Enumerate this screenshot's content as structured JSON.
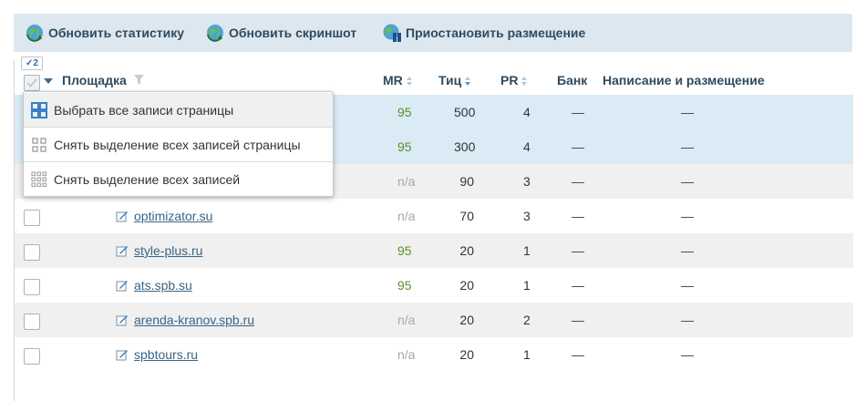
{
  "toolbar": {
    "refresh_stats": "Обновить статистику",
    "refresh_screenshot": "Обновить скриншот",
    "pause_placement": "Приостановить размещение"
  },
  "selection": {
    "count": "2",
    "check_mark": "✓"
  },
  "columns": {
    "site": "Площадка",
    "mr": "MR",
    "tic": "Тиц",
    "pr": "PR",
    "bank": "Банк",
    "writing": "Написание и размещение"
  },
  "dropdown": {
    "select_page": "Выбрать все записи страницы",
    "deselect_page": "Снять выделение всех записей страницы",
    "deselect_all": "Снять выделение всех записей"
  },
  "rows": [
    {
      "site": "",
      "mr": "95",
      "tic": "500",
      "pr": "4",
      "bank": "—",
      "writing": "—",
      "selected": true
    },
    {
      "site": "",
      "mr": "95",
      "tic": "300",
      "pr": "4",
      "bank": "—",
      "writing": "—",
      "selected": true
    },
    {
      "site": "",
      "mr": "n/a",
      "tic": "90",
      "pr": "3",
      "bank": "—",
      "writing": "—",
      "selected": false
    },
    {
      "site": "optimizator.su",
      "mr": "n/a",
      "tic": "70",
      "pr": "3",
      "bank": "—",
      "writing": "—",
      "selected": false
    },
    {
      "site": "style-plus.ru",
      "mr": "95",
      "tic": "20",
      "pr": "1",
      "bank": "—",
      "writing": "—",
      "selected": false
    },
    {
      "site": "ats.spb.su",
      "mr": "95",
      "tic": "20",
      "pr": "1",
      "bank": "—",
      "writing": "—",
      "selected": false
    },
    {
      "site": "arenda-kranov.spb.ru",
      "mr": "n/a",
      "tic": "20",
      "pr": "2",
      "bank": "—",
      "writing": "—",
      "selected": false
    },
    {
      "site": "spbtours.ru",
      "mr": "n/a",
      "tic": "20",
      "pr": "1",
      "bank": "—",
      "writing": "—",
      "selected": false
    }
  ],
  "colors": {
    "accent": "#2f4a5e",
    "selected_row": "#daebf6",
    "mr_good": "#5b8f2a",
    "mr_na": "#a8a8a8"
  }
}
